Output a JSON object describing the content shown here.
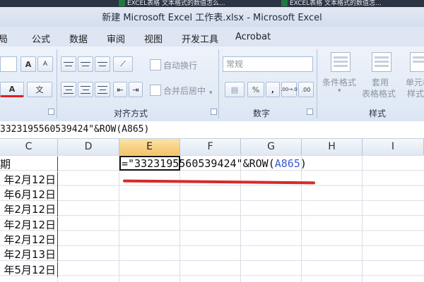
{
  "browser_tabs": [
    "EXCEL表格 文本格式的数值怎么...",
    "EXCEL表格 文本格式的数值怎..."
  ],
  "window_title": "新建 Microsoft Excel 工作表.xlsx - Microsoft Excel",
  "menu_tabs": [
    "局",
    "公式",
    "数据",
    "审阅",
    "视图",
    "开发工具",
    "Acrobat"
  ],
  "ribbon": {
    "wrap_text": "自动换行",
    "merge_center": "合并后居中",
    "number_format": "常规",
    "percent": "%",
    "comma": ",",
    "inc_decimal": ".00→.0",
    "dec_decimal": ".00",
    "font_size_up": "A",
    "font_size_down": "A",
    "font_color": "A",
    "phonetic": "文",
    "conditional_format": "条件格式",
    "table_format_1": "套用",
    "table_format_2": "表格格式",
    "cell_style_1": "单元格",
    "cell_style_2": "样式",
    "group_alignment": "对齐方式",
    "group_number": "数字",
    "group_style": "样式"
  },
  "formula_bar": {
    "content": "3323195560539424\"&ROW(A865)"
  },
  "columns": [
    "C",
    "D",
    "E",
    "F",
    "G",
    "H",
    "I"
  ],
  "active_column": "E",
  "column_c_cells": [
    "期",
    "年2月12日",
    "年6月12日",
    "年2月12日",
    "年2月12日",
    "年2月12日",
    "年2月13日",
    "年5月12日"
  ],
  "cell_formula": {
    "prefix": "=\"3323195560539424\"&ROW(",
    "ref": "A865",
    "suffix": ")"
  },
  "colors": {
    "ref_blue": "#3b5bd6",
    "annotation_red": "#d62a2a",
    "active_header": "#f3c46a"
  }
}
